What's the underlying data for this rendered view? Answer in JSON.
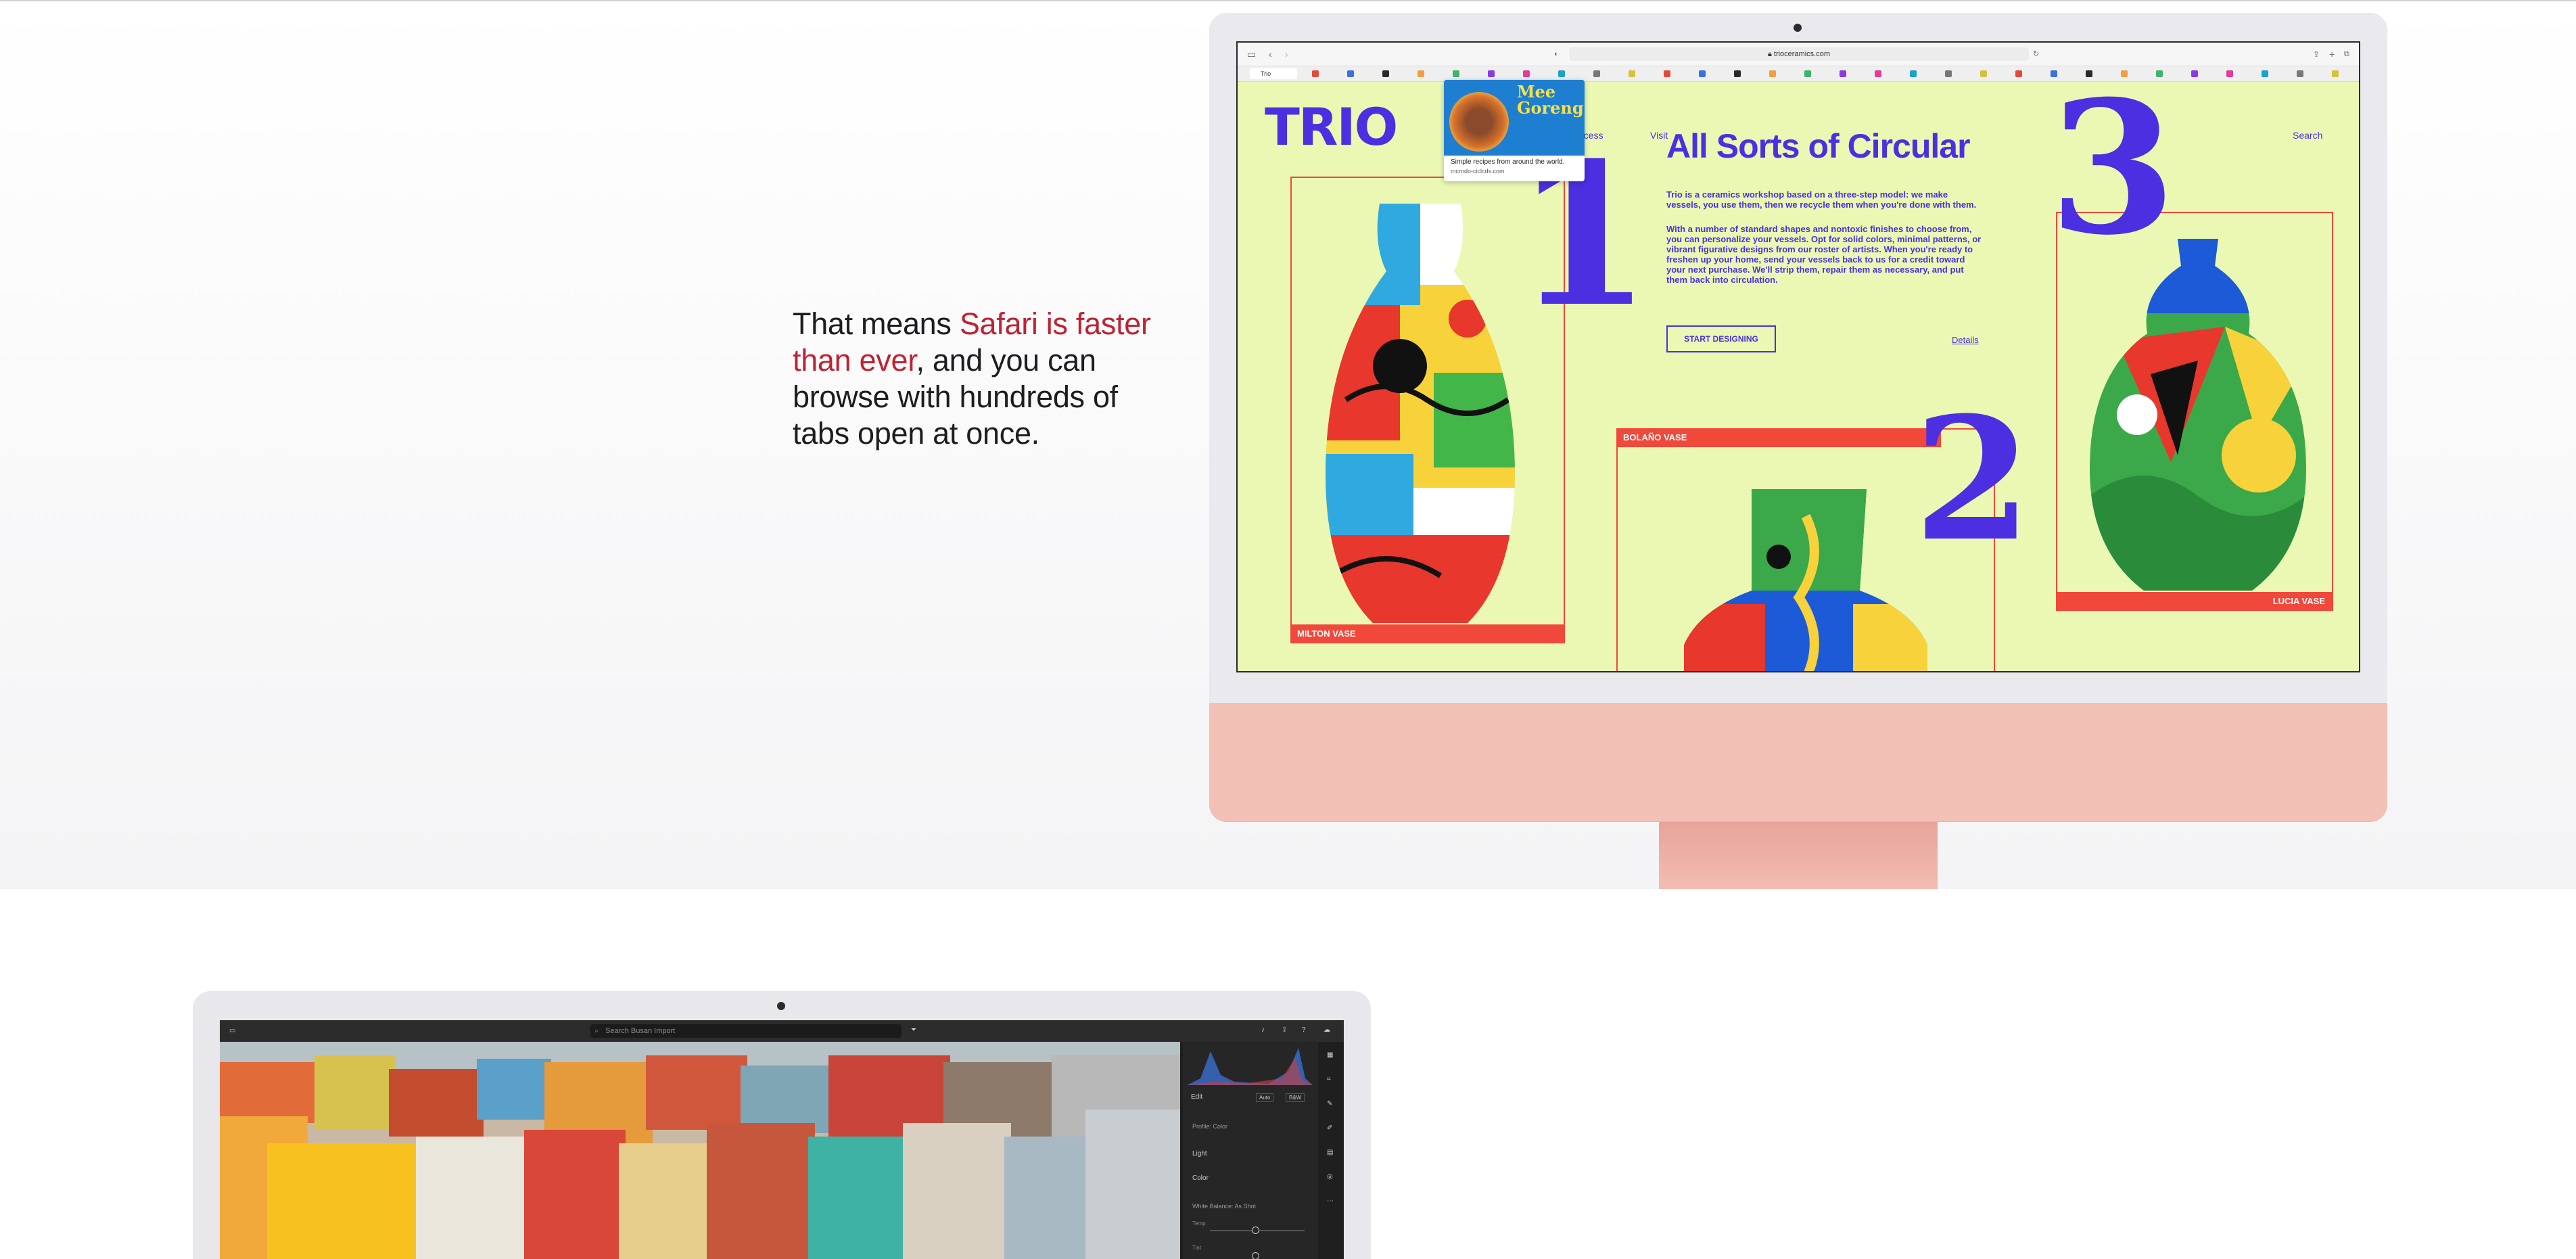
{
  "headline": {
    "part1": "That means ",
    "highlight": "Safari is faster than ever",
    "part2": ", and you can browse with hundreds of tabs open at once."
  },
  "colors": {
    "accent": "#bf2233",
    "trio_blue": "#4b2fe0",
    "trio_bg": "#eaf8b4",
    "trio_red": "#f0483a",
    "imac_pink": "#f3c0b6"
  },
  "safari": {
    "address": "trioceramics.com",
    "first_tab": "Trio",
    "icons": [
      "sidebar-icon",
      "back-icon",
      "forward-icon",
      "share-icon",
      "new-tab-icon",
      "tab-overview-icon"
    ]
  },
  "tooltip": {
    "title": "Mee Goreng",
    "caption": "Simple recipes from around the world.",
    "url": "mcrndo-ciclcds.com"
  },
  "trio_page": {
    "logo": "TRIO",
    "nav": [
      "Process",
      "Visit",
      "Search"
    ],
    "heading": "All Sorts of Circular",
    "para1": "Trio is a ceramics workshop based on a three-step model: we make vessels, you use them, then we recycle them when you're done with them.",
    "para2": "With a number of standard shapes and nontoxic finishes to choose from, you can personalize your vessels. Opt for solid colors, minimal patterns, or vibrant figurative designs from our roster of artists. When you're ready to freshen up your home, send your vessels back to us for a credit toward your next purchase. We'll strip them, repair them as necessary, and put them back into circulation.",
    "start_button": "START DESIGNING",
    "details_link": "Details",
    "numbers": [
      "1",
      "2",
      "3"
    ],
    "vases": [
      "MILTON VASE",
      "BOLAÑO VASE",
      "LUCIA VASE"
    ]
  },
  "lightroom": {
    "search_placeholder": "Search Busan Import",
    "panel": {
      "edit": "Edit",
      "auto": "Auto",
      "bw": "B&W",
      "profile": "Profile: Color",
      "light": "Light",
      "color": "Color",
      "white_balance": "White Balance: As Shot",
      "temp": "Temp",
      "tint": "Tint"
    }
  }
}
